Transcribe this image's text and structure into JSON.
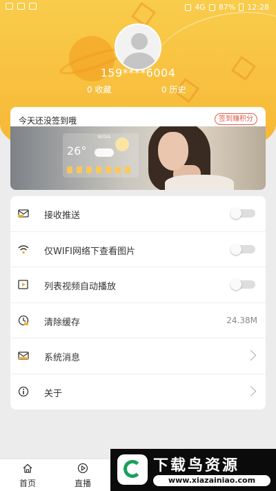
{
  "status_bar": {
    "left_icons": [
      "image-icon",
      "image-icon",
      "checkbox-icon"
    ],
    "network_label": "4G",
    "battery": "87%",
    "time": "12:28"
  },
  "profile": {
    "phone": "159****6004",
    "favorites": "0 收藏",
    "history": "0 历史"
  },
  "checkin": {
    "title": "今天还没签到哦",
    "button": "签到赚积分",
    "banner_city": "SEOUL",
    "banner_temp": "26°"
  },
  "settings": {
    "items": [
      {
        "label": "接收推送",
        "type": "toggle",
        "on": false,
        "icon": "envelope-icon"
      },
      {
        "label": "仅WIFI网络下查看图片",
        "type": "toggle",
        "on": false,
        "icon": "wifi-icon"
      },
      {
        "label": "列表视频自动播放",
        "type": "toggle",
        "on": false,
        "icon": "video-icon"
      },
      {
        "label": "清除缓存",
        "type": "value",
        "value": "24.38M",
        "icon": "clock-icon"
      },
      {
        "label": "系统消息",
        "type": "link",
        "icon": "mail-icon"
      },
      {
        "label": "关于",
        "type": "link",
        "icon": "info-icon"
      }
    ]
  },
  "tabbar": {
    "home": "首页",
    "live": "直播"
  },
  "watermark": {
    "title": "下载鸟资源",
    "url": "www.xiazainiao.com"
  },
  "colors": {
    "header": "#f7bd3a",
    "accent_red": "#e05b4a",
    "background": "#ececec"
  }
}
